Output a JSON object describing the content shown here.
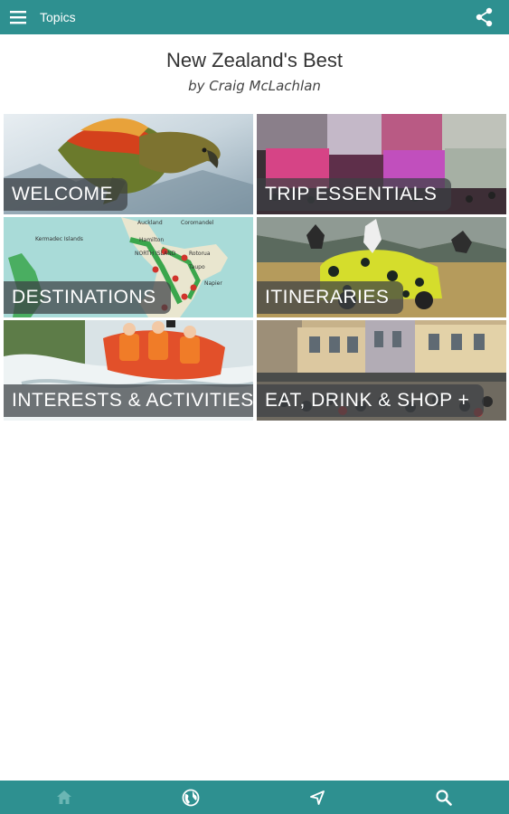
{
  "topbar": {
    "title": "Topics"
  },
  "header": {
    "title": "New Zealand's Best",
    "author": "by Craig McLachlan"
  },
  "tiles": [
    {
      "label": "WELCOME"
    },
    {
      "label": "TRIP ESSENTIALS"
    },
    {
      "label": "DESTINATIONS"
    },
    {
      "label": "ITINERARIES"
    },
    {
      "label": "INTERESTS & ACTIVITIES"
    },
    {
      "label": "EAT, DRINK & SHOP +"
    }
  ],
  "map_labels": [
    "Auckland",
    "Coromandel",
    "Hamilton",
    "NORTH ISLAND",
    "Rotorua",
    "Taupo",
    "Napier",
    "Kermadec Islands"
  ],
  "colors": {
    "bar": "#2e9090",
    "label_bg": "#3c4044"
  },
  "bottom_nav": [
    {
      "icon": "home-icon",
      "active": true
    },
    {
      "icon": "globe-icon",
      "active": false
    },
    {
      "icon": "navigate-icon",
      "active": false
    },
    {
      "icon": "search-icon",
      "active": false
    }
  ]
}
